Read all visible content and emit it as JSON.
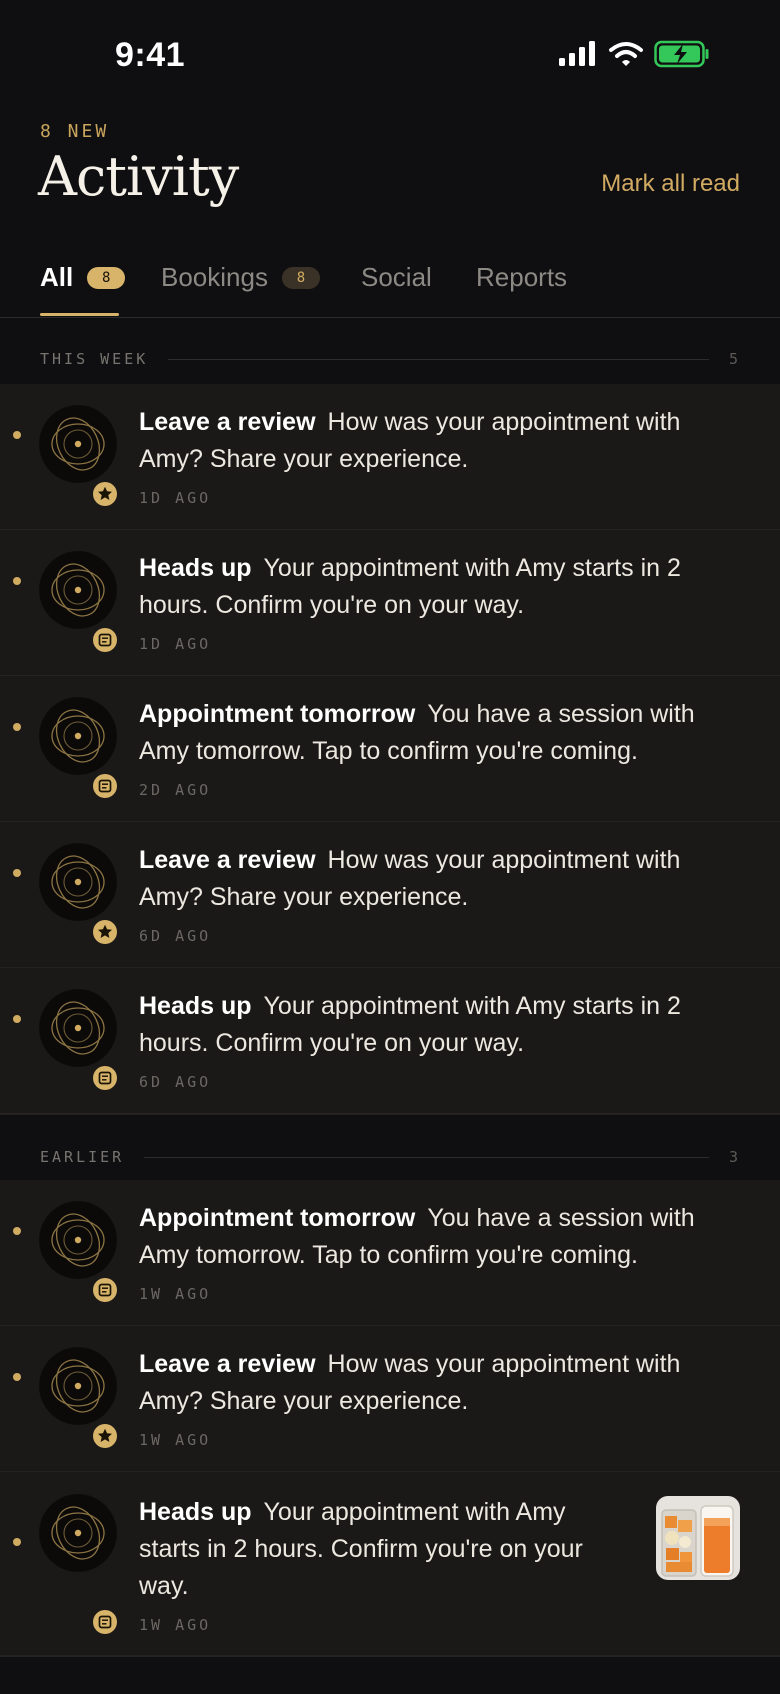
{
  "status_bar": {
    "time": "9:41"
  },
  "header": {
    "new_count": "8 NEW",
    "title": "Activity",
    "mark_all_read": "Mark all read"
  },
  "tabs": [
    {
      "label": "All",
      "badge": "8"
    },
    {
      "label": "Bookings",
      "badge": "8"
    },
    {
      "label": "Social"
    },
    {
      "label": "Reports"
    }
  ],
  "sections": [
    {
      "label": "THIS WEEK",
      "count": "5"
    },
    {
      "label": "EARLIER",
      "count": "3"
    }
  ],
  "notifications": [
    {
      "title": "Leave a review",
      "body": "How was your appointment with Amy? Share your experience.",
      "time": "1D AGO",
      "badge_icon": "star-icon"
    },
    {
      "title": "Heads up",
      "body": "Your appointment with Amy starts in 2 hours. Confirm you're on your way.",
      "time": "1D AGO",
      "badge_icon": "message-icon"
    },
    {
      "title": "Appointment tomorrow",
      "body": "You have a session with Amy tomorrow. Tap to confirm you're coming.",
      "time": "2D AGO",
      "badge_icon": "message-icon"
    },
    {
      "title": "Leave a review",
      "body": "How was your appointment with Amy? Share your experience.",
      "time": "6D AGO",
      "badge_icon": "star-icon"
    },
    {
      "title": "Heads up",
      "body": "Your appointment with Amy starts in 2 hours. Confirm you're on your way.",
      "time": "6D AGO",
      "badge_icon": "message-icon"
    },
    {
      "title": "Appointment tomorrow",
      "body": "You have a session with Amy tomorrow. Tap to confirm you're coming.",
      "time": "1W AGO",
      "badge_icon": "message-icon"
    },
    {
      "title": "Leave a review",
      "body": "How was your appointment with Amy? Share your experience.",
      "time": "1W AGO",
      "badge_icon": "star-icon"
    },
    {
      "title": "Heads up",
      "body": "Your appointment with Amy starts in 2 hours. Confirm you're on your way.",
      "time": "1W AGO",
      "badge_icon": "message-icon",
      "thumbnail": "smoothie-photo"
    }
  ],
  "colors": {
    "accent": "#d8b46a",
    "background": "#0f0f11",
    "card": "#1a1918",
    "battery": "#34c759"
  }
}
